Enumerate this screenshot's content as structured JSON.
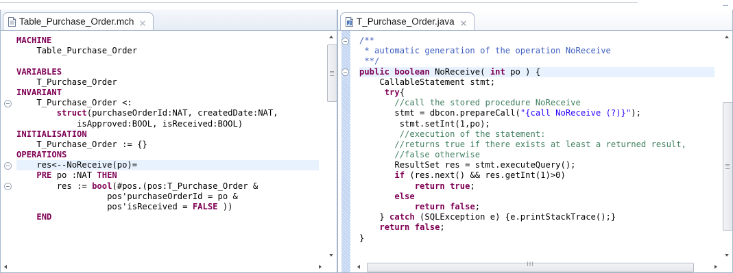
{
  "left_editor": {
    "tab": {
      "title": "Table_Purchase_Order.mch",
      "file_icon": "text-file-icon",
      "close_icon": "close-icon"
    },
    "lines": [
      [
        {
          "t": "MACHINE",
          "c": "kw"
        }
      ],
      [
        {
          "t": "    Table_Purchase_Order"
        }
      ],
      [
        {
          "t": ""
        }
      ],
      [
        {
          "t": "VARIABLES",
          "c": "kw"
        }
      ],
      [
        {
          "t": "    T_Purchase_Order"
        }
      ],
      [
        {
          "t": "INVARIANT",
          "c": "kw"
        }
      ],
      [
        {
          "t": "    T_Purchase_Order <:"
        }
      ],
      [
        {
          "t": "        "
        },
        {
          "t": "struct",
          "c": "kw"
        },
        {
          "t": "(purchaseOrderId:NAT, createdDate:NAT,"
        }
      ],
      [
        {
          "t": "            isApproved:BOOL, isReceived:BOOL)"
        }
      ],
      [
        {
          "t": "INITIALISATION",
          "c": "kw"
        }
      ],
      [
        {
          "t": "    T_Purchase_Order := {}"
        }
      ],
      [
        {
          "t": "OPERATIONS",
          "c": "kw"
        }
      ],
      [
        {
          "t": "    res<--NoReceive(po)="
        }
      ],
      [
        {
          "t": "    "
        },
        {
          "t": "PRE",
          "c": "kw"
        },
        {
          "t": " po :NAT "
        },
        {
          "t": "THEN",
          "c": "kw"
        }
      ],
      [
        {
          "t": "        res := "
        },
        {
          "t": "bool",
          "c": "kw"
        },
        {
          "t": "(#pos.(pos:T_Purchase_Order &"
        }
      ],
      [
        {
          "t": "                  pos'purchaseOrderId = po &"
        }
      ],
      [
        {
          "t": "                  pos'isReceived = "
        },
        {
          "t": "FALSE",
          "c": "kw"
        },
        {
          "t": " ))"
        }
      ],
      [
        {
          "t": "    "
        },
        {
          "t": "END",
          "c": "kw"
        }
      ]
    ],
    "fold_markers": [
      6,
      12,
      14
    ],
    "current_line": 12
  },
  "right_editor": {
    "tab": {
      "title": "T_Purchase_Order.java",
      "file_icon": "java-file-icon",
      "close_icon": "close-icon"
    },
    "lines": [
      [
        {
          "t": "/**",
          "c": "jd"
        }
      ],
      [
        {
          "t": " * automatic generation of the operation NoReceive",
          "c": "jd"
        }
      ],
      [
        {
          "t": " **/",
          "c": "jd"
        }
      ],
      [
        {
          "t": "public",
          "c": "kw"
        },
        {
          "t": " "
        },
        {
          "t": "boolean",
          "c": "kw"
        },
        {
          "t": " NoReceive( "
        },
        {
          "t": "int",
          "c": "kw"
        },
        {
          "t": " po ) {"
        }
      ],
      [
        {
          "t": "    CallableStatement stmt;"
        }
      ],
      [
        {
          "t": "     "
        },
        {
          "t": "try",
          "c": "kw"
        },
        {
          "t": "{"
        }
      ],
      [
        {
          "t": "       "
        },
        {
          "t": "//call the stored procedure NoReceive",
          "c": "cm"
        }
      ],
      [
        {
          "t": "       stmt = dbcon.prepareCall("
        },
        {
          "t": "\"{call NoReceive (?)}\"",
          "c": "st"
        },
        {
          "t": ");"
        }
      ],
      [
        {
          "t": "        stmt.setInt(1,po);"
        }
      ],
      [
        {
          "t": "        "
        },
        {
          "t": "//execution of the statement:",
          "c": "cm"
        }
      ],
      [
        {
          "t": "       "
        },
        {
          "t": "//returns true if there exists at least a returned result,",
          "c": "cm"
        }
      ],
      [
        {
          "t": "       "
        },
        {
          "t": "//false otherwise",
          "c": "cm"
        }
      ],
      [
        {
          "t": "       ResultSet res = stmt.executeQuery();"
        }
      ],
      [
        {
          "t": "       "
        },
        {
          "t": "if",
          "c": "kw"
        },
        {
          "t": " (res.next() && res.getInt(1)>0)"
        }
      ],
      [
        {
          "t": "           "
        },
        {
          "t": "return",
          "c": "kw"
        },
        {
          "t": " "
        },
        {
          "t": "true",
          "c": "kw"
        },
        {
          "t": ";"
        }
      ],
      [
        {
          "t": "       "
        },
        {
          "t": "else",
          "c": "kw"
        }
      ],
      [
        {
          "t": "           "
        },
        {
          "t": "return",
          "c": "kw"
        },
        {
          "t": " "
        },
        {
          "t": "false",
          "c": "kw"
        },
        {
          "t": ";"
        }
      ],
      [
        {
          "t": "    } "
        },
        {
          "t": "catch",
          "c": "kw"
        },
        {
          "t": " (SQLException e) {e.printStackTrace();}"
        }
      ],
      [
        {
          "t": "    "
        },
        {
          "t": "return",
          "c": "kw"
        },
        {
          "t": " "
        },
        {
          "t": "false",
          "c": "kw"
        },
        {
          "t": ";"
        }
      ],
      [
        {
          "t": "}"
        }
      ]
    ],
    "fold_markers": [
      0,
      3
    ],
    "current_line": 3,
    "hscroll_grip": "III"
  },
  "colors": {
    "keyword": "#7f0055",
    "comment": "#3f7f5f",
    "javadoc": "#3f5fbf",
    "string": "#2a00ff",
    "current_line_bg": "#e8f2fe",
    "frame_border": "#a6b6cd"
  },
  "window_controls": {
    "maximize_icon": "maximize-icon"
  }
}
